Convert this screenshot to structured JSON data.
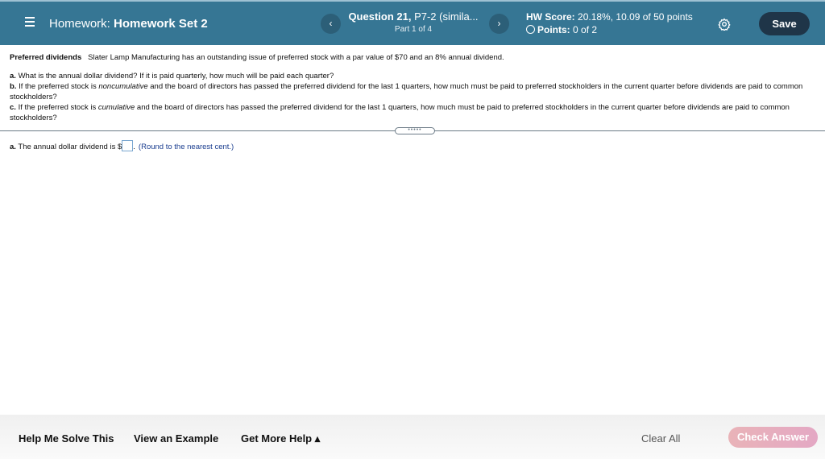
{
  "header": {
    "menu_icon": "hamburger-icon",
    "hw_label": "Homework:",
    "hw_name": "Homework Set 2",
    "prev_label": "‹",
    "next_label": "›",
    "question_bold": "Question 21,",
    "question_rest": " P7-2 (simila...",
    "part": "Part 1 of 4",
    "score_label": "HW Score:",
    "score_value": " 20.18%, 10.09 of 50 points",
    "points_label": "Points:",
    "points_value": " 0 of 2",
    "settings_icon": "gear-icon",
    "save_label": "Save"
  },
  "problem": {
    "title": "Preferred dividends",
    "intro": "Slater Lamp Manufacturing has an outstanding issue of preferred stock with a par value of $70 and an 8% annual dividend.",
    "a_label": "a.",
    "a_text": " What is the annual dollar dividend?  If it is paid quarterly, how much will be paid each quarter?",
    "b_label": "b.",
    "b_pre": " If the preferred stock is ",
    "b_em": "noncumulative",
    "b_post": " and the board of directors has passed the preferred dividend for the last 1 quarters, how much must be paid to preferred stockholders in the current quarter before dividends are paid to common stockholders?",
    "c_label": "c.",
    "c_pre": " If the preferred stock is ",
    "c_em": "cumulative",
    "c_post": " and the board of directors has passed the preferred dividend for the last 1 quarters, how much must be paid to preferred stockholders in the current quarter before dividends are paid to common stockholders?"
  },
  "expander_label": "•••••",
  "answer": {
    "label": "a.",
    "text": " The annual dollar dividend is $",
    "value": "",
    "suffix": ".",
    "hint": "(Round to the nearest cent.)"
  },
  "footer": {
    "help_solve": "Help Me Solve This",
    "view_example": "View an Example",
    "more_help": "Get More Help ▴",
    "clear_all": "Clear All",
    "check_answer": "Check Answer"
  }
}
